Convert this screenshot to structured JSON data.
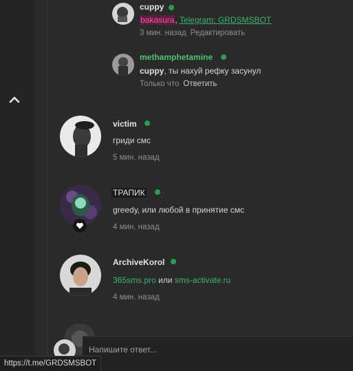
{
  "comments": [
    {
      "username": "cuppy",
      "mention": "bakasura",
      "separator": ", ",
      "link_text": "Telegram: GRDSMSBOT",
      "time": "3 мин. назад",
      "action": "Редактировать"
    },
    {
      "username": "methamphetamine",
      "mention": "cuppy",
      "text": ", ты нахуй рефку засунул",
      "time": "Только что",
      "action": "Ответить"
    },
    {
      "username": "victim",
      "text": "гриди смс",
      "time": "5 мин. назад"
    },
    {
      "username": "ТРАПИК",
      "text": "greedy, или любой в принятие смс",
      "time": "4 мин. назад"
    },
    {
      "username": "ArchiveKorol",
      "link1": "365sms.pro",
      "connector": " или ",
      "link2": "sms-activate.ru",
      "time": "4 мин. назад"
    }
  ],
  "reply": {
    "placeholder": "Напишите ответ..."
  },
  "status_bar": {
    "url": "https://t.me/GRDSMSBOT"
  },
  "colors": {
    "online": "#2e9b55",
    "link": "#3fb36b",
    "mention_highlight": "#ff4fa8",
    "username_green": "#4cc46f"
  }
}
